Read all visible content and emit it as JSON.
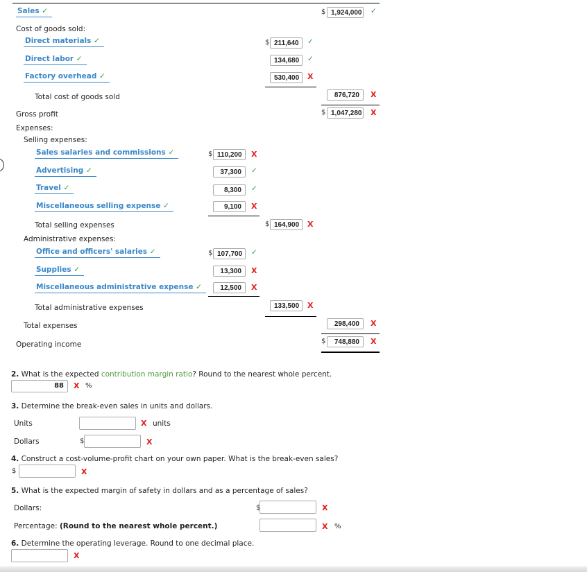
{
  "statement": {
    "sales": {
      "label": "Sales",
      "value": "1,924,000",
      "label_mark": "check",
      "value_mark": "check"
    },
    "cogs_header": "Cost of goods sold:",
    "cogs_items": [
      {
        "label": "Direct materials",
        "value": "211,640",
        "value_mark": "check"
      },
      {
        "label": "Direct labor",
        "value": "134,680",
        "value_mark": "check"
      },
      {
        "label": "Factory overhead",
        "value": "530,400",
        "value_mark": "x"
      }
    ],
    "total_cogs": {
      "label": "Total cost of goods sold",
      "value": "876,720",
      "value_mark": "x"
    },
    "gross_profit": {
      "label": "Gross profit",
      "value": "1,047,280",
      "value_mark": "x"
    },
    "expenses_header": "Expenses:",
    "selling_header": "Selling expenses:",
    "selling_items": [
      {
        "label": "Sales salaries and commissions",
        "value": "110,200",
        "value_mark": "x"
      },
      {
        "label": "Advertising",
        "value": "37,300",
        "value_mark": "check"
      },
      {
        "label": "Travel",
        "value": "8,300",
        "value_mark": "check"
      },
      {
        "label": "Miscellaneous selling expense",
        "value": "9,100",
        "value_mark": "x"
      }
    ],
    "total_selling": {
      "label": "Total selling expenses",
      "value": "164,900",
      "value_mark": "x"
    },
    "admin_header": "Administrative expenses:",
    "admin_items": [
      {
        "label": "Office and officers' salaries",
        "value": "107,700",
        "value_mark": "check"
      },
      {
        "label": "Supplies",
        "value": "13,300",
        "value_mark": "x"
      },
      {
        "label": "Miscellaneous administrative expense",
        "value": "12,500",
        "value_mark": "x"
      }
    ],
    "total_admin": {
      "label": "Total administrative expenses",
      "value": "133,500",
      "value_mark": "x"
    },
    "total_expenses": {
      "label": "Total expenses",
      "value": "298,400",
      "value_mark": "x"
    },
    "operating_income": {
      "label": "Operating income",
      "value": "748,880",
      "value_mark": "x"
    }
  },
  "symbols": {
    "dollar": "$",
    "check": "✓",
    "x": "X",
    "percent": "%"
  },
  "q2": {
    "num": "2.",
    "pre": "What is the expected ",
    "link": "contribution margin ratio",
    "post": "? Round to the nearest whole percent.",
    "value": "88"
  },
  "q3": {
    "num": "3.",
    "text": "Determine the break-even sales in units and dollars.",
    "units_label": "Units",
    "units_suffix": "units",
    "dollars_label": "Dollars",
    "units_value": "",
    "dollars_value": ""
  },
  "q4": {
    "num": "4.",
    "text": "Construct a cost-volume-profit chart on your own paper. What is the break-even sales?",
    "value": ""
  },
  "q5": {
    "num": "5.",
    "text": "What is the expected margin of safety in dollars and as a percentage of sales?",
    "dollars_label": "Dollars:",
    "percentage_label": "Percentage:",
    "percentage_note": "(Round to the nearest whole percent.)",
    "dollars_value": "",
    "percentage_value": ""
  },
  "q6": {
    "num": "6.",
    "text": "Determine the operating leverage. Round to one decimal place.",
    "value": ""
  },
  "colors": {
    "label_blue": "#3a87c8",
    "check_green": "#2e9e3a",
    "error_red": "#e0201b",
    "link_green": "#4b9b3a"
  }
}
